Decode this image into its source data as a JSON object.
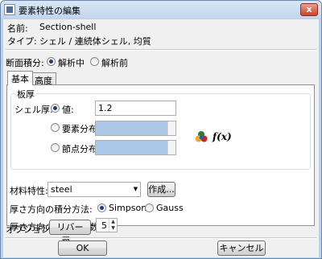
{
  "window": {
    "title": "要素特性の編集",
    "close_glyph": "x"
  },
  "header": {
    "name_label": "名前:",
    "name_value": "Section-shell",
    "type_label": "タイプ:",
    "type_value": "シェル / 連続体シェル, 均質"
  },
  "integration": {
    "label": "断面積分:",
    "options": [
      "解析中",
      "解析前"
    ],
    "selected": 0
  },
  "tabs": [
    "基本",
    "高度"
  ],
  "thickness": {
    "group_title": "板厚",
    "shell_label": "シェル厚:",
    "options": [
      {
        "label": "値:",
        "value": "1.2"
      },
      {
        "label": "要素分布:",
        "value": ""
      },
      {
        "label": "節点分布:",
        "value": ""
      }
    ],
    "fx_label": "f(x)"
  },
  "material": {
    "label": "材料特性:",
    "value": "steel",
    "create_button": "作成..."
  },
  "rule": {
    "label": "厚さ方向の積分方法:",
    "options": [
      "Simpson",
      "Gauss"
    ],
    "selected": 0
  },
  "points": {
    "label": "厚さ方向の積分点の数:",
    "value": "5"
  },
  "options_row": {
    "label": "オプション:",
    "button": "リバー層..."
  },
  "footer": {
    "ok": "OK",
    "cancel": "キャンセル"
  },
  "colors": {
    "disabled_field": "#abc7e8",
    "frame": "#b9d1ea"
  }
}
